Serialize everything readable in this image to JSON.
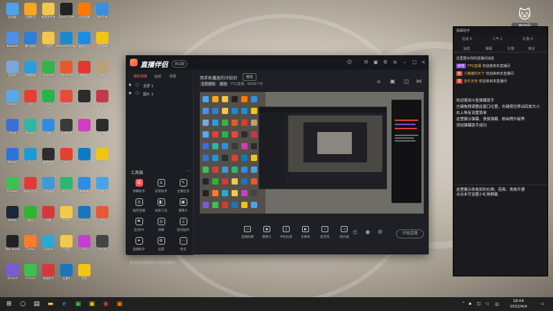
{
  "desktop": {
    "icons": [
      {
        "label": "此电脑",
        "color": "#4ea3e8"
      },
      {
        "label": "迅雷影音",
        "color": "#f5a623"
      },
      {
        "label": "新建文件夹",
        "color": "#f3c64f"
      },
      {
        "label": "Grand Theft",
        "color": "#222"
      },
      {
        "label": "斗鱼直播",
        "color": "#ff7a00"
      },
      {
        "label": "WeChat",
        "color": "#3b8de0"
      },
      {
        "label": "Network",
        "color": "#4d8fe0"
      },
      {
        "label": "腾讯游戏",
        "color": "#2e7dd6"
      },
      {
        "label": "小程序",
        "color": "#f3c64f"
      },
      {
        "label": "Microsoft Edge",
        "color": "#1e88c9"
      },
      {
        "label": "酷狗音乐",
        "color": "#1a8de0"
      },
      {
        "label": "叨叨游戏",
        "color": "#f0c419"
      },
      {
        "label": "回收站",
        "color": "#7aa7d8"
      },
      {
        "label": "控制面板",
        "color": "#2d9cdb"
      },
      {
        "label": "Tencent",
        "color": "#36b34a"
      },
      {
        "label": "SteamVR",
        "color": "#e55a2b"
      },
      {
        "label": "网易云",
        "color": "#e2372f"
      },
      {
        "label": "原神",
        "color": "#b9a07a"
      },
      {
        "label": "Remote",
        "color": "#5aa8e8"
      },
      {
        "label": "QQ",
        "color": "#e24033"
      },
      {
        "label": "OBS",
        "color": "#2ab34a"
      },
      {
        "label": "快手",
        "color": "#e84a3a"
      },
      {
        "label": "网易游戏",
        "color": "#2c2c2c"
      },
      {
        "label": "Apex",
        "color": "#c23a4a"
      },
      {
        "label": "Flash",
        "color": "#3a6fd6"
      },
      {
        "label": "Player",
        "color": "#2eb8a4"
      },
      {
        "label": "迅雷",
        "color": "#2d8ee0"
      },
      {
        "label": "英雄联盟",
        "color": "#3a3a3a"
      },
      {
        "label": "App",
        "color": "#d23cc2"
      },
      {
        "label": "LOL",
        "color": "#2c2c2c"
      },
      {
        "label": "Steam",
        "color": "#2d73d6"
      },
      {
        "label": "音乐",
        "color": "#1c9ad6"
      },
      {
        "label": "高德地图",
        "color": "#2d2d2d"
      },
      {
        "label": "Global",
        "color": "#e24033"
      },
      {
        "label": "Edge",
        "color": "#0f7ac2"
      },
      {
        "label": "叨叨",
        "color": "#f0c419"
      },
      {
        "label": "Chrome",
        "color": "#3fbf52"
      },
      {
        "label": "网易云音乐",
        "color": "#e23a3a"
      },
      {
        "label": "远程桌面",
        "color": "#3d9ad6"
      },
      {
        "label": "QQ音乐",
        "color": "#2bb673"
      },
      {
        "label": "Kugou",
        "color": "#2d8ee0"
      },
      {
        "label": "直播助手",
        "color": "#4aa3e8"
      },
      {
        "label": "Steam",
        "color": "#1b2838"
      },
      {
        "label": "微信",
        "color": "#2db52f"
      },
      {
        "label": "炫舞",
        "color": "#d23a3a"
      },
      {
        "label": "PUBG",
        "color": "#f2c94c"
      },
      {
        "label": "Gaming",
        "color": "#1b75bb"
      },
      {
        "label": "WPS",
        "color": "#e35a3a"
      },
      {
        "label": "OBS Studio",
        "color": "#222"
      },
      {
        "label": "Firefox",
        "color": "#ff7b2c"
      },
      {
        "label": "Games",
        "color": "#2aa8d6"
      },
      {
        "label": "YY语音",
        "color": "#f2c94c"
      },
      {
        "label": "Tool",
        "color": "#c63dd2"
      },
      {
        "label": "Studio",
        "color": "#444"
      },
      {
        "label": "Discord",
        "color": "#7a5ad6"
      },
      {
        "label": "Chrome",
        "color": "#3fbf52"
      },
      {
        "label": "网络助手",
        "color": "#d23a3a"
      },
      {
        "label": "迅雷X",
        "color": "#1b75bb"
      },
      {
        "label": "叨叨",
        "color": "#f0c419"
      }
    ]
  },
  "app": {
    "name": "直播伴侣",
    "badge": "测试版",
    "left_tabs": [
      "我的场景",
      "画面",
      "弹幕"
    ],
    "sources": [
      {
        "name": "全屏 1"
      },
      {
        "name": "图片 1"
      }
    ],
    "tools_header": "工具箱",
    "tools": [
      {
        "label": "弹幕助手",
        "icon": "☰",
        "hot": true
      },
      {
        "label": "房管助手",
        "icon": "♙",
        "hot": false
      },
      {
        "label": "主播任务",
        "icon": "✎",
        "hot": false
      },
      {
        "label": "抽奖直播",
        "icon": "◎",
        "hot": false
      },
      {
        "label": "录屏工具",
        "icon": "◧",
        "hot": false
      },
      {
        "label": "摄像头",
        "icon": "▣",
        "hot": false
      },
      {
        "label": "连线PK",
        "icon": "⚑",
        "hot": false
      },
      {
        "label": "弹幕",
        "icon": "◎",
        "hot": false
      },
      {
        "label": "歌词插件",
        "icon": "♫",
        "hot": false
      },
      {
        "label": "直播助手",
        "icon": "✦",
        "hot": false
      },
      {
        "label": "设置",
        "icon": "⚙",
        "hot": false
      },
      {
        "label": "更多",
        "icon": "⋯",
        "hot": false
      }
    ],
    "notice": "如何把手机摄像头加到直播中?",
    "room_title": "用手机播放的冷知识",
    "edit_label": "修改",
    "tags": [
      "主机游戏",
      "其他"
    ],
    "room_info": "YTG直播 · 9606778",
    "bottom_buttons": [
      {
        "label": "直播屏幕",
        "icon": "▭"
      },
      {
        "label": "摄像头",
        "icon": "◉"
      },
      {
        "label": "手机投屏",
        "icon": "▯"
      },
      {
        "label": "多媒体",
        "icon": "▶"
      },
      {
        "label": "麦克风",
        "icon": "♪"
      },
      {
        "label": "扬声器",
        "icon": "◁"
      }
    ],
    "live_button": "开始直播"
  },
  "chat": {
    "title": "弹幕助手",
    "stats": [
      {
        "label": "在线",
        "value": "0"
      },
      {
        "label": "人气",
        "value": "2"
      },
      {
        "label": "礼物",
        "value": "0"
      }
    ],
    "tabs": [
      "消息",
      "弹幕",
      "礼物",
      "禁言"
    ],
    "messages": [
      {
        "prefix": "",
        "prefix_color": "#2d6cd8",
        "who": "",
        "text": "这里展示你的直播间消息"
      },
      {
        "prefix": "房管",
        "prefix_color": "#7a4ad6",
        "who": "YTG直播",
        "text": "欢迎来到本直播间"
      },
      {
        "prefix": "粉",
        "prefix_color": "#e24033",
        "who": "小猪猪的天下",
        "text": "欢迎来到本直播间"
      },
      {
        "prefix": "贵",
        "prefix_color": "#e24033",
        "who": "音乐天地",
        "text": "欢迎来到本直播间"
      }
    ],
    "notes": [
      "欢迎使用斗鱼弹幕助手",
      "左键拖拽调整此窗口位置，右键按住移动后放大小",
      "右上角有设置菜单",
      "这里展示弹幕、贵族弹幕、粉丝牌升级等",
      "添加弹幕助手成功"
    ],
    "gift_note": "这里展示你收到的礼物、道具、贵族开通\n点击本可设置小礼物屏蔽"
  },
  "room": {
    "label": "房间号",
    "number": "9606778"
  },
  "taskbar": {
    "time": "18:04",
    "date": "2022/4/4",
    "tray_lang": "中"
  }
}
